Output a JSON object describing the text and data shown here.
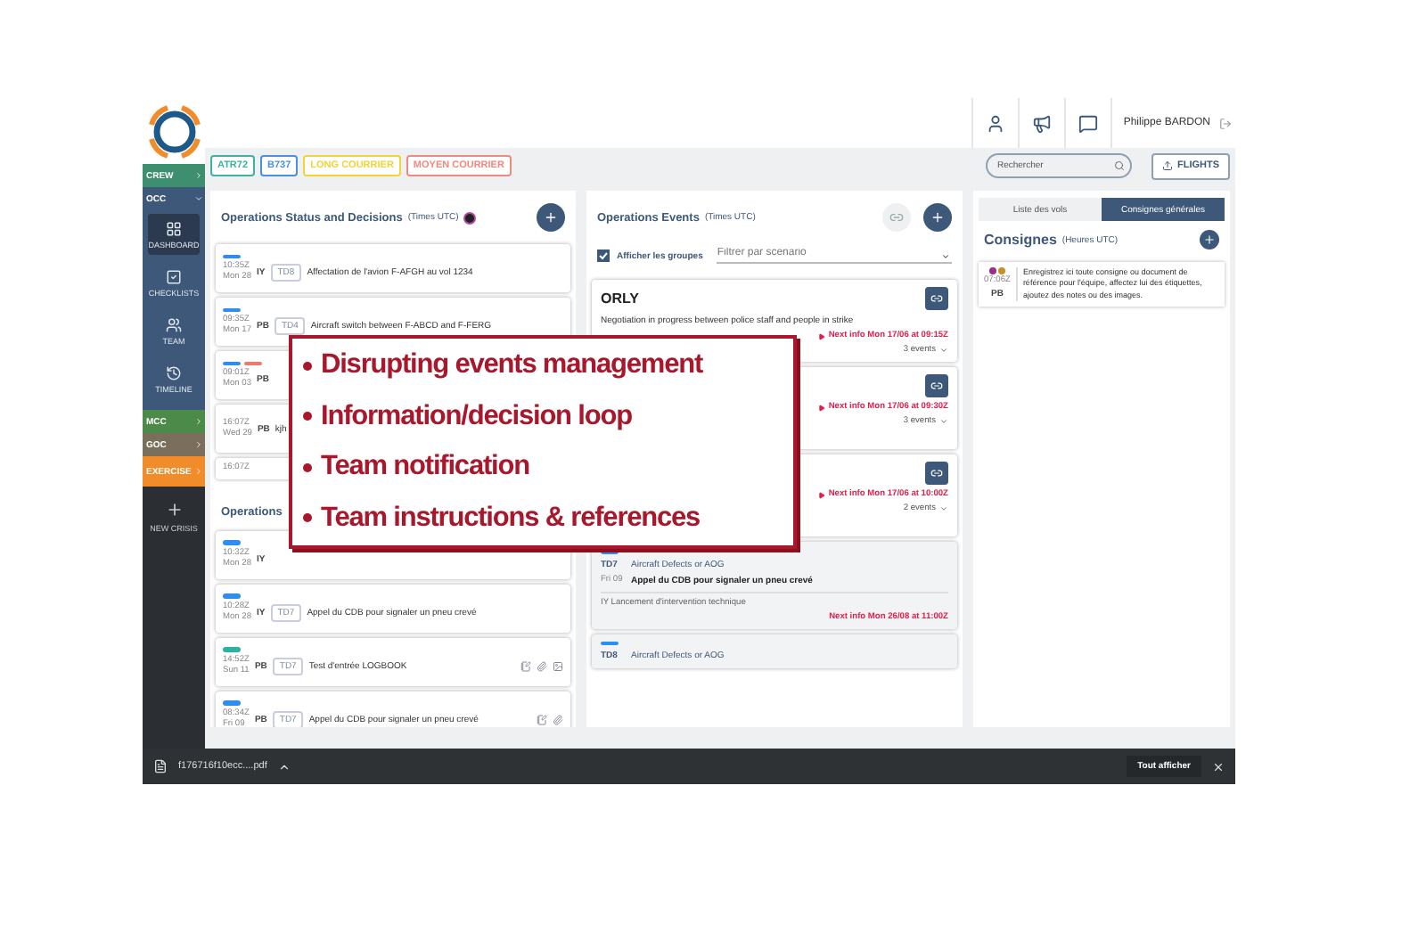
{
  "header": {
    "user_name": "Philippe BARDON"
  },
  "tags": [
    {
      "label": "ATR72",
      "color": "#3bb3a0"
    },
    {
      "label": "B737",
      "color": "#4a90e2"
    },
    {
      "label": "LONG COURRIER",
      "color": "#f0d43a"
    },
    {
      "label": "MOYEN COURRIER",
      "color": "#f08a80"
    }
  ],
  "search": {
    "placeholder": "Rechercher"
  },
  "flights_button": "FLIGHTS",
  "sidebar": {
    "groups": [
      {
        "label": "CREW",
        "color": "#3e8f6f",
        "expanded": false
      },
      {
        "label": "OCC",
        "color": "#3d5878",
        "expanded": true,
        "items": [
          {
            "label": "DASHBOARD",
            "kind": "dashboard",
            "selected": true
          },
          {
            "label": "CHECKLISTS",
            "kind": "checklist",
            "selected": false
          },
          {
            "label": "TEAM",
            "kind": "team",
            "selected": false
          },
          {
            "label": "TIMELINE",
            "kind": "timeline",
            "selected": false
          }
        ]
      },
      {
        "label": "MCC",
        "color": "#4c8a4a",
        "expanded": false
      },
      {
        "label": "GOC",
        "color": "#7a6f5c",
        "expanded": false
      },
      {
        "label": "EXERCISE",
        "color": "#f08c2a",
        "expanded": false
      }
    ],
    "new_crisis": "NEW CRISIS"
  },
  "status_panel": {
    "title": "Operations Status and Decisions",
    "subtitle": "(Times UTC)",
    "items": [
      {
        "bars": [
          {
            "color": "#2d8ef0"
          }
        ],
        "time": "10:35Z",
        "day": "Mon 28",
        "operator": "IY",
        "code": "TD8",
        "text": "Affectation de l'avion F-AFGH au vol 1234"
      },
      {
        "bars": [
          {
            "color": "#2d8ef0"
          }
        ],
        "time": "09:35Z",
        "day": "Mon 17",
        "operator": "PB",
        "code": "TD4",
        "text": "Aircraft switch between F-ABCD and F-FERG"
      },
      {
        "bars": [
          {
            "color": "#2d8ef0"
          },
          {
            "color": "#f07a6a"
          }
        ],
        "time": "09:01Z",
        "day": "Mon 03",
        "operator": "PB"
      },
      {
        "time": "16:07Z",
        "day": "Wed 29",
        "operator": "PB",
        "text": "kjh"
      },
      {
        "time": "16:07Z"
      }
    ]
  },
  "operations_panel": {
    "title": "Operations",
    "items": [
      {
        "bars": [
          {
            "color": "#2d8ef0"
          }
        ],
        "time": "10:32Z",
        "day": "Mon 28",
        "operator": "IY"
      },
      {
        "bars": [
          {
            "color": "#2d8ef0"
          }
        ],
        "time": "10:28Z",
        "day": "Mon 28",
        "operator": "IY",
        "code": "TD7",
        "text": "Appel du CDB pour signaler un pneu crevé"
      },
      {
        "bars": [
          {
            "color": "#2bb3a0"
          }
        ],
        "time": "14:52Z",
        "day": "Sun 11",
        "operator": "PB",
        "code": "TD7",
        "text": "Test d'entrée LOGBOOK",
        "attachments": [
          {
            "kind": "note"
          },
          {
            "kind": "clip"
          },
          {
            "kind": "image"
          }
        ]
      },
      {
        "bars": [
          {
            "color": "#2d8ef0"
          }
        ],
        "time": "08:34Z",
        "day": "Fri 09",
        "operator": "PB",
        "code": "TD7",
        "text": "Appel du CDB pour signaler un pneu crevé",
        "attachments": [
          {
            "kind": "note"
          },
          {
            "kind": "clip"
          }
        ]
      }
    ]
  },
  "events_panel": {
    "title": "Operations Events",
    "subtitle": "(Times UTC)",
    "show_groups": {
      "label": "Afficher les groupes",
      "checked": true
    },
    "filter": {
      "placeholder": "Filtrer par scenario"
    },
    "groups": [
      {
        "kind": "group",
        "title": "ORLY",
        "text": "Negotiation in progress between police staff and people in strike",
        "next_info": "Next info Mon 17/06 at 09:15Z",
        "count": "3 events"
      },
      {
        "kind": "group",
        "next_info": "Next info Mon 17/06 at 09:30Z",
        "count": "3 events"
      },
      {
        "kind": "group",
        "next_info": "Next info Mon 17/06 at 10:00Z",
        "count": "2 events"
      },
      {
        "kind": "event",
        "code": "TD7",
        "category": "Aircraft Defects or AOG",
        "day": "Fri 09",
        "title": "Appel du CDB pour signaler un pneu crevé",
        "action": "IY Lancement d'intervention technique",
        "next_info": "Next info Mon 26/08 at 11:00Z"
      },
      {
        "kind": "event",
        "code": "TD8",
        "category": "Aircraft Defects or AOG"
      }
    ]
  },
  "right_panel": {
    "tabs": [
      {
        "label": "Liste des vols",
        "selected": false
      },
      {
        "label": "Consignes générales",
        "selected": true
      }
    ],
    "title": "Consignes",
    "subtitle": "(Heures UTC)",
    "notes": [
      {
        "dots": [
          {
            "color": "#9b2d8a"
          },
          {
            "color": "#c8902a"
          }
        ],
        "time": "07:06Z",
        "operator": "PB",
        "text": "Enregistrez ici toute consigne ou document de référence pour l'équipe, affectez lui des étiquettes, ajoutez des notes ou des images."
      }
    ]
  },
  "download_bar": {
    "file": "f176716f10ecc....pdf",
    "show_all": "Tout afficher"
  },
  "callout": [
    "Disrupting events management",
    "Information/decision loop",
    "Team notification",
    "Team instructions & references"
  ]
}
